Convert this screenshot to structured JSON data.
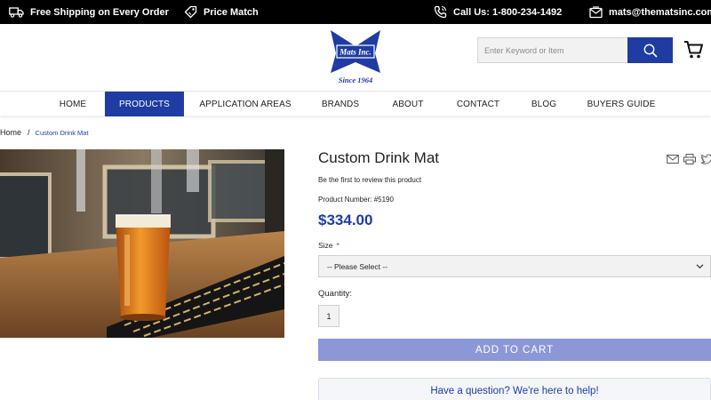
{
  "topbar": {
    "shipping": {
      "icon": "truck-icon",
      "label": "Free Shipping on Every Order"
    },
    "price_match": {
      "icon": "tag-icon",
      "label": "Price Match"
    },
    "phone": {
      "icon": "phone-icon",
      "label": "Call Us: 1-800-234-1492"
    },
    "email": {
      "icon": "mail-icon",
      "label": "mats@themat​sinc.com"
    }
  },
  "logo": {
    "brand": "Mats Inc.",
    "tagline": "Since 1964"
  },
  "search": {
    "placeholder": "Enter Keyword or Item",
    "button_icon": "search-icon"
  },
  "cart": {
    "icon": "cart-icon"
  },
  "nav": {
    "items": [
      {
        "label": "HOME"
      },
      {
        "label": "PRODUCTS",
        "active": true
      },
      {
        "label": "APPLICATION AREAS"
      },
      {
        "label": "BRANDS"
      },
      {
        "label": "ABOUT"
      },
      {
        "label": "CONTACT"
      },
      {
        "label": "BLOG"
      },
      {
        "label": "BUYERS GUIDE"
      }
    ]
  },
  "breadcrumb": {
    "home": "Home",
    "separator": "/",
    "current": "Custom Drink Mat"
  },
  "product": {
    "title": "Custom Drink Mat",
    "review_link": "Be the first to review this product",
    "product_number": "Product Number: #5190",
    "price": "$334.00",
    "size_label": "Size",
    "size_required_marker": "*",
    "size_selected": "-- Please Select --",
    "quantity_label": "Quantity:",
    "quantity_value": "1",
    "add_to_cart": "ADD TO CART",
    "help_text": "Have a question? We're here to help!",
    "share_icons": [
      "email-icon",
      "print-icon",
      "twitter-icon"
    ]
  },
  "colors": {
    "brand_blue": "#1f3ca3",
    "add_to_cart_bg": "#8c97d8",
    "topbar_bg": "#000000"
  }
}
